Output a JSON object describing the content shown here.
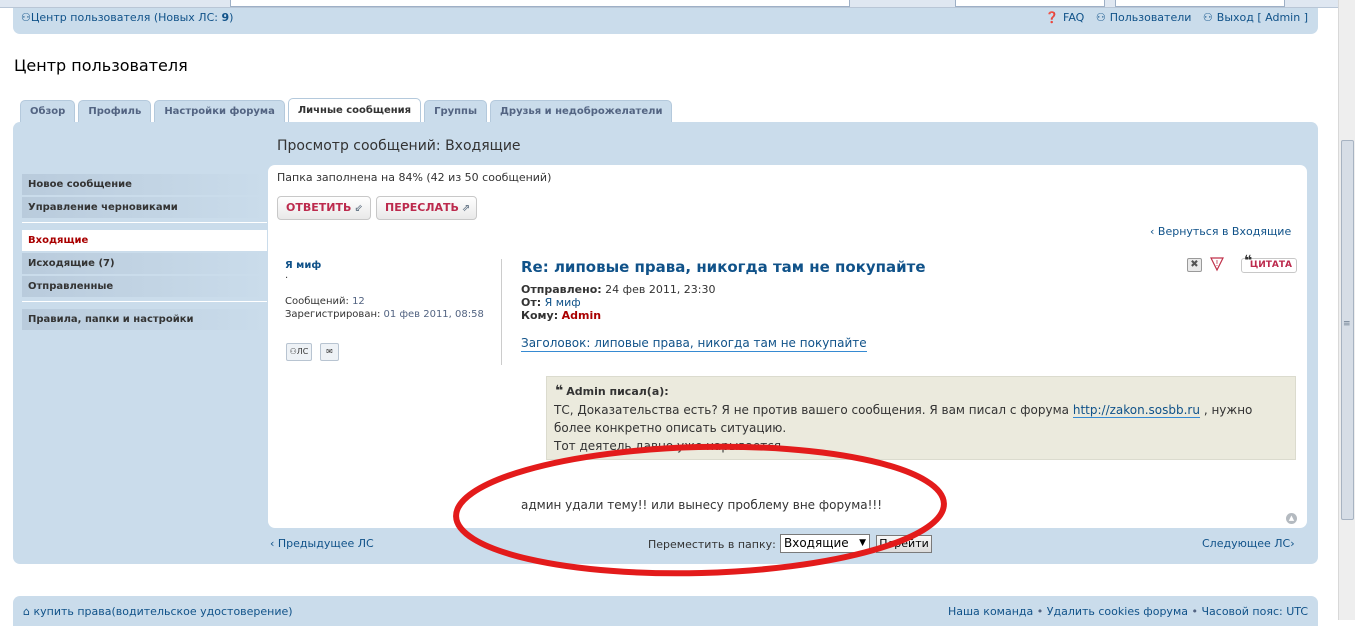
{
  "topbar": {
    "user_center": "Центр пользователя",
    "new_pm_prefix": "(Новых ЛС: ",
    "new_pm_count": "9",
    "new_pm_suffix": ")",
    "faq": "FAQ",
    "members": "Пользователи",
    "logout": "Выход [ Admin ]"
  },
  "page_title": "Центр пользователя",
  "tabs": [
    {
      "label": "Обзор"
    },
    {
      "label": "Профиль"
    },
    {
      "label": "Настройки форума"
    },
    {
      "label": "Личные сообщения",
      "active": true
    },
    {
      "label": "Группы"
    },
    {
      "label": "Друзья и недоброжелатели"
    }
  ],
  "leftnav": {
    "compose": "Новое сообщение",
    "drafts": "Управление черновиками",
    "inbox": "Входящие",
    "outbox": "Исходящие (7)",
    "sent": "Отправленные",
    "rules": "Правила, папки и настройки"
  },
  "content_title": "Просмотр сообщений: Входящие",
  "folder_status": "Папка заполнена на 84% (42 из 50 сообщений)",
  "buttons": {
    "reply": "ОТВЕТИТЬ",
    "forward": "ПЕРЕСЛАТЬ",
    "quote": "ЦИТАТА",
    "pm": "ЛС"
  },
  "back_link": "Вернуться в Входящие",
  "author": {
    "name": "Я миф",
    "rank": "·",
    "posts_label": "Сообщений:",
    "posts_value": "12",
    "reg_label": "Зарегистрирован:",
    "reg_value": "01 фев 2011, 08:58"
  },
  "post": {
    "subject": "Re: липовые права, никогда там не покупайте",
    "sent_label": "Отправлено:",
    "sent_value": "24 фев 2011, 23:30",
    "from_label": "От:",
    "from_value": "Я миф",
    "to_label": "Кому:",
    "to_value": "Admin",
    "heading": "Заголовок: липовые права, никогда там не покупайте",
    "quote_author": "Admin писал(а):",
    "quote_line1a": "ТС, Доказательства есть? Я не против вашего сообщения. Я вам писал с форума",
    "quote_link": "http://zakon.sosbb.ru",
    "quote_line1b": ", нужно более конкретно описать ситуацию.",
    "quote_line2": "Тот деятель давно уже нарывается...",
    "body": "админ удали тему!! или вынесу проблему вне форума!!!"
  },
  "bottom": {
    "prev": "Предыдущее ЛС",
    "move_label": "Переместить в папку:",
    "move_value": "Входящие",
    "move_button": "Перейти",
    "next": "Следующее ЛС"
  },
  "footer": {
    "left": "купить права(водительское удостоверение)",
    "team": "Наша команда",
    "cookies": "Удалить cookies форума",
    "tz": "Часовой пояс: UTC"
  },
  "colors": {
    "accent": "#105289",
    "panel": "#cadceb",
    "annotation": "#e31b1b"
  }
}
